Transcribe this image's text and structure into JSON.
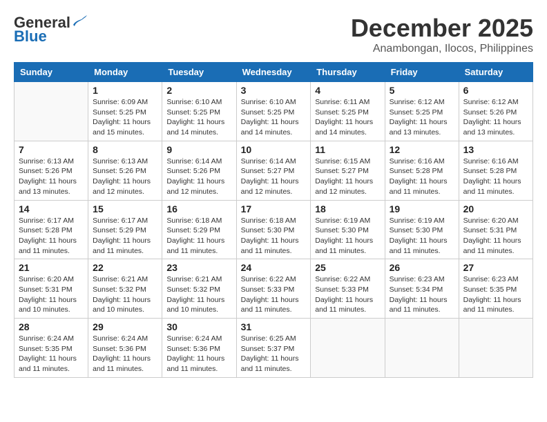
{
  "logo": {
    "text_general": "General",
    "text_blue": "Blue"
  },
  "title": "December 2025",
  "location": "Anambongan, Ilocos, Philippines",
  "days_of_week": [
    "Sunday",
    "Monday",
    "Tuesday",
    "Wednesday",
    "Thursday",
    "Friday",
    "Saturday"
  ],
  "weeks": [
    [
      {
        "day": "",
        "info": ""
      },
      {
        "day": "1",
        "info": "Sunrise: 6:09 AM\nSunset: 5:25 PM\nDaylight: 11 hours\nand 15 minutes."
      },
      {
        "day": "2",
        "info": "Sunrise: 6:10 AM\nSunset: 5:25 PM\nDaylight: 11 hours\nand 14 minutes."
      },
      {
        "day": "3",
        "info": "Sunrise: 6:10 AM\nSunset: 5:25 PM\nDaylight: 11 hours\nand 14 minutes."
      },
      {
        "day": "4",
        "info": "Sunrise: 6:11 AM\nSunset: 5:25 PM\nDaylight: 11 hours\nand 14 minutes."
      },
      {
        "day": "5",
        "info": "Sunrise: 6:12 AM\nSunset: 5:25 PM\nDaylight: 11 hours\nand 13 minutes."
      },
      {
        "day": "6",
        "info": "Sunrise: 6:12 AM\nSunset: 5:26 PM\nDaylight: 11 hours\nand 13 minutes."
      }
    ],
    [
      {
        "day": "7",
        "info": "Sunrise: 6:13 AM\nSunset: 5:26 PM\nDaylight: 11 hours\nand 13 minutes."
      },
      {
        "day": "8",
        "info": "Sunrise: 6:13 AM\nSunset: 5:26 PM\nDaylight: 11 hours\nand 12 minutes."
      },
      {
        "day": "9",
        "info": "Sunrise: 6:14 AM\nSunset: 5:26 PM\nDaylight: 11 hours\nand 12 minutes."
      },
      {
        "day": "10",
        "info": "Sunrise: 6:14 AM\nSunset: 5:27 PM\nDaylight: 11 hours\nand 12 minutes."
      },
      {
        "day": "11",
        "info": "Sunrise: 6:15 AM\nSunset: 5:27 PM\nDaylight: 11 hours\nand 12 minutes."
      },
      {
        "day": "12",
        "info": "Sunrise: 6:16 AM\nSunset: 5:28 PM\nDaylight: 11 hours\nand 11 minutes."
      },
      {
        "day": "13",
        "info": "Sunrise: 6:16 AM\nSunset: 5:28 PM\nDaylight: 11 hours\nand 11 minutes."
      }
    ],
    [
      {
        "day": "14",
        "info": "Sunrise: 6:17 AM\nSunset: 5:28 PM\nDaylight: 11 hours\nand 11 minutes."
      },
      {
        "day": "15",
        "info": "Sunrise: 6:17 AM\nSunset: 5:29 PM\nDaylight: 11 hours\nand 11 minutes."
      },
      {
        "day": "16",
        "info": "Sunrise: 6:18 AM\nSunset: 5:29 PM\nDaylight: 11 hours\nand 11 minutes."
      },
      {
        "day": "17",
        "info": "Sunrise: 6:18 AM\nSunset: 5:30 PM\nDaylight: 11 hours\nand 11 minutes."
      },
      {
        "day": "18",
        "info": "Sunrise: 6:19 AM\nSunset: 5:30 PM\nDaylight: 11 hours\nand 11 minutes."
      },
      {
        "day": "19",
        "info": "Sunrise: 6:19 AM\nSunset: 5:30 PM\nDaylight: 11 hours\nand 11 minutes."
      },
      {
        "day": "20",
        "info": "Sunrise: 6:20 AM\nSunset: 5:31 PM\nDaylight: 11 hours\nand 11 minutes."
      }
    ],
    [
      {
        "day": "21",
        "info": "Sunrise: 6:20 AM\nSunset: 5:31 PM\nDaylight: 11 hours\nand 10 minutes."
      },
      {
        "day": "22",
        "info": "Sunrise: 6:21 AM\nSunset: 5:32 PM\nDaylight: 11 hours\nand 10 minutes."
      },
      {
        "day": "23",
        "info": "Sunrise: 6:21 AM\nSunset: 5:32 PM\nDaylight: 11 hours\nand 10 minutes."
      },
      {
        "day": "24",
        "info": "Sunrise: 6:22 AM\nSunset: 5:33 PM\nDaylight: 11 hours\nand 11 minutes."
      },
      {
        "day": "25",
        "info": "Sunrise: 6:22 AM\nSunset: 5:33 PM\nDaylight: 11 hours\nand 11 minutes."
      },
      {
        "day": "26",
        "info": "Sunrise: 6:23 AM\nSunset: 5:34 PM\nDaylight: 11 hours\nand 11 minutes."
      },
      {
        "day": "27",
        "info": "Sunrise: 6:23 AM\nSunset: 5:35 PM\nDaylight: 11 hours\nand 11 minutes."
      }
    ],
    [
      {
        "day": "28",
        "info": "Sunrise: 6:24 AM\nSunset: 5:35 PM\nDaylight: 11 hours\nand 11 minutes."
      },
      {
        "day": "29",
        "info": "Sunrise: 6:24 AM\nSunset: 5:36 PM\nDaylight: 11 hours\nand 11 minutes."
      },
      {
        "day": "30",
        "info": "Sunrise: 6:24 AM\nSunset: 5:36 PM\nDaylight: 11 hours\nand 11 minutes."
      },
      {
        "day": "31",
        "info": "Sunrise: 6:25 AM\nSunset: 5:37 PM\nDaylight: 11 hours\nand 11 minutes."
      },
      {
        "day": "",
        "info": ""
      },
      {
        "day": "",
        "info": ""
      },
      {
        "day": "",
        "info": ""
      }
    ]
  ]
}
